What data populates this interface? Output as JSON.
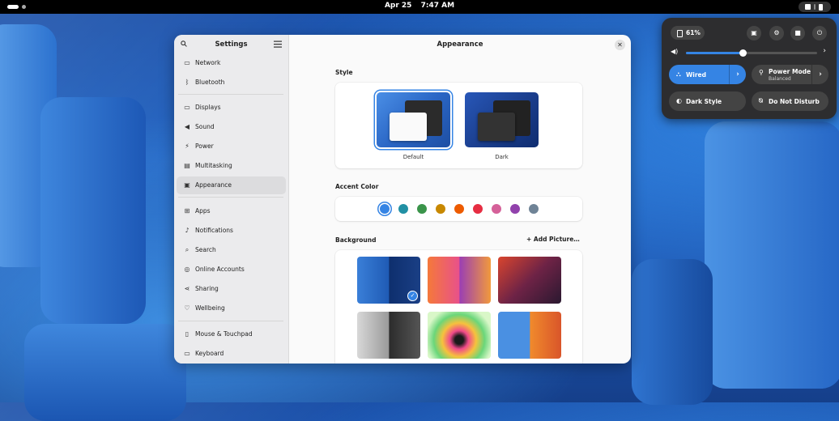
{
  "topbar": {
    "date": "Apr 25",
    "time": "7:47 AM"
  },
  "settings": {
    "sidebar_title": "Settings",
    "main_title": "Appearance",
    "sidebar_items": [
      {
        "label": "Network",
        "icon": "network-icon"
      },
      {
        "label": "Bluetooth",
        "icon": "bluetooth-icon"
      },
      {
        "label": "Displays",
        "icon": "display-icon"
      },
      {
        "label": "Sound",
        "icon": "sound-icon"
      },
      {
        "label": "Power",
        "icon": "power-icon"
      },
      {
        "label": "Multitasking",
        "icon": "multitasking-icon"
      },
      {
        "label": "Appearance",
        "icon": "appearance-icon",
        "active": true
      },
      {
        "label": "Apps",
        "icon": "apps-icon"
      },
      {
        "label": "Notifications",
        "icon": "notifications-icon"
      },
      {
        "label": "Search",
        "icon": "search-icon"
      },
      {
        "label": "Online Accounts",
        "icon": "online-accounts-icon"
      },
      {
        "label": "Sharing",
        "icon": "sharing-icon"
      },
      {
        "label": "Wellbeing",
        "icon": "wellbeing-icon"
      },
      {
        "label": "Mouse & Touchpad",
        "icon": "mouse-icon"
      },
      {
        "label": "Keyboard",
        "icon": "keyboard-icon"
      }
    ],
    "style": {
      "label": "Style",
      "options": [
        {
          "label": "Default",
          "selected": true
        },
        {
          "label": "Dark",
          "selected": false
        }
      ]
    },
    "accent": {
      "label": "Accent Color",
      "colors": [
        "#3584e4",
        "#2190a4",
        "#3a944a",
        "#c88800",
        "#ed5b00",
        "#e62d42",
        "#d56199",
        "#9141ac",
        "#6f8396"
      ],
      "selected_index": 0
    },
    "background": {
      "label": "Background",
      "add_label": "Add Picture…",
      "selected_index": 0
    }
  },
  "quick_settings": {
    "battery": "61%",
    "volume_level": 0.43,
    "wired_label": "Wired",
    "power_mode_label": "Power Mode",
    "power_mode_value": "Balanced",
    "dark_style_label": "Dark Style",
    "dnd_label": "Do Not Disturb"
  }
}
